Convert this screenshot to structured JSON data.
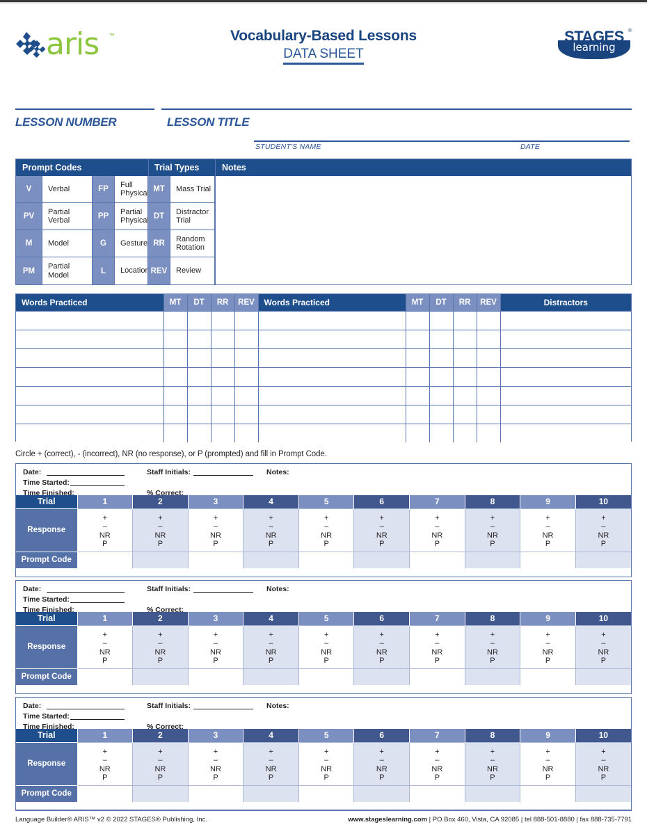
{
  "document": {
    "title": "Vocabulary-Based Lessons",
    "subtitle": "DATA SHEET",
    "brand_left": "aris",
    "brand_left_tm": "™",
    "brand_right_top": "STAGES",
    "brand_right_reg": "®",
    "brand_right_bottom": "learning"
  },
  "colors": {
    "header_blue": "#1f4e8c",
    "mid_blue": "#7b8fc0",
    "dark_cell_blue": "#41588f",
    "side_label_blue": "#5671a8",
    "tint_lavender": "#dde2f0",
    "rule_blue": "#2a5699",
    "border_blue": "#5a75ad",
    "logo_green": "#8cc63f"
  },
  "lesson": {
    "number_label": "LESSON NUMBER",
    "title_label": "LESSON TITLE",
    "student_name_label": "STUDENT'S NAME",
    "date_label": "DATE",
    "number_value": "",
    "title_value": "",
    "student_name_value": "",
    "date_value": ""
  },
  "prompt_codes": {
    "header_prompt_codes": "Prompt Codes",
    "header_trial_types": "Trial Types",
    "header_notes": "Notes",
    "notes_value": "",
    "column_a": [
      {
        "abbr": "V",
        "name": "Verbal"
      },
      {
        "abbr": "PV",
        "name": "Partial Verbal"
      },
      {
        "abbr": "M",
        "name": "Model"
      },
      {
        "abbr": "PM",
        "name": "Partial Model"
      }
    ],
    "column_b": [
      {
        "abbr": "FP",
        "name": "Full Physical"
      },
      {
        "abbr": "PP",
        "name": "Partial Physical"
      },
      {
        "abbr": "G",
        "name": "Gesture"
      },
      {
        "abbr": "L",
        "name": "Location"
      }
    ],
    "column_c": [
      {
        "abbr": "MT",
        "name": "Mass Trial"
      },
      {
        "abbr": "DT",
        "name": "Distractor Trial"
      },
      {
        "abbr": "RR",
        "name": "Random Rotation"
      },
      {
        "abbr": "REV",
        "name": "Review"
      }
    ]
  },
  "words_practiced": {
    "headers": {
      "words_1": "Words Practiced",
      "mt_1": "MT",
      "dt_1": "DT",
      "rr_1": "RR",
      "rev_1": "REV",
      "words_2": "Words Practiced",
      "mt_2": "MT",
      "dt_2": "DT",
      "rr_2": "RR",
      "rev_2": "REV",
      "distractors": "Distractors"
    },
    "row_count": 7,
    "rows": [
      {
        "words_1": "",
        "mt_1": "",
        "dt_1": "",
        "rr_1": "",
        "rev_1": "",
        "words_2": "",
        "mt_2": "",
        "dt_2": "",
        "rr_2": "",
        "rev_2": "",
        "distractors": ""
      },
      {
        "words_1": "",
        "mt_1": "",
        "dt_1": "",
        "rr_1": "",
        "rev_1": "",
        "words_2": "",
        "mt_2": "",
        "dt_2": "",
        "rr_2": "",
        "rev_2": "",
        "distractors": ""
      },
      {
        "words_1": "",
        "mt_1": "",
        "dt_1": "",
        "rr_1": "",
        "rev_1": "",
        "words_2": "",
        "mt_2": "",
        "dt_2": "",
        "rr_2": "",
        "rev_2": "",
        "distractors": ""
      },
      {
        "words_1": "",
        "mt_1": "",
        "dt_1": "",
        "rr_1": "",
        "rev_1": "",
        "words_2": "",
        "mt_2": "",
        "dt_2": "",
        "rr_2": "",
        "rev_2": "",
        "distractors": ""
      },
      {
        "words_1": "",
        "mt_1": "",
        "dt_1": "",
        "rr_1": "",
        "rev_1": "",
        "words_2": "",
        "mt_2": "",
        "dt_2": "",
        "rr_2": "",
        "rev_2": "",
        "distractors": ""
      },
      {
        "words_1": "",
        "mt_1": "",
        "dt_1": "",
        "rr_1": "",
        "rev_1": "",
        "words_2": "",
        "mt_2": "",
        "dt_2": "",
        "rr_2": "",
        "rev_2": "",
        "distractors": ""
      },
      {
        "words_1": "",
        "mt_1": "",
        "dt_1": "",
        "rr_1": "",
        "rev_1": "",
        "words_2": "",
        "mt_2": "",
        "dt_2": "",
        "rr_2": "",
        "rev_2": "",
        "distractors": ""
      }
    ]
  },
  "instruction": "Circle + (correct), - (incorrect), NR (no response), or P (prompted) and fill in Prompt Code.",
  "trial_meta_labels": {
    "date": "Date:",
    "time_started": "Time Started:",
    "time_finished": "Time Finished:",
    "staff_initials": "Staff Initials:",
    "percent_correct": "% Correct:",
    "notes": "Notes:"
  },
  "trial_grid": {
    "row_label_trial": "Trial",
    "row_label_response": "Response",
    "row_label_prompt_code": "Prompt Code",
    "trial_numbers": [
      "1",
      "2",
      "3",
      "4",
      "5",
      "6",
      "7",
      "8",
      "9",
      "10"
    ],
    "response_options": [
      "+",
      "–",
      "NR",
      "P"
    ]
  },
  "trial_blocks": [
    {
      "date": "",
      "time_started": "",
      "time_finished": "",
      "staff_initials": "",
      "percent_correct": "",
      "notes": "",
      "prompt_codes": [
        "",
        "",
        "",
        "",
        "",
        "",
        "",
        "",
        "",
        ""
      ]
    },
    {
      "date": "",
      "time_started": "",
      "time_finished": "",
      "staff_initials": "",
      "percent_correct": "",
      "notes": "",
      "prompt_codes": [
        "",
        "",
        "",
        "",
        "",
        "",
        "",
        "",
        "",
        ""
      ]
    },
    {
      "date": "",
      "time_started": "",
      "time_finished": "",
      "staff_initials": "",
      "percent_correct": "",
      "notes": "",
      "prompt_codes": [
        "",
        "",
        "",
        "",
        "",
        "",
        "",
        "",
        "",
        ""
      ]
    }
  ],
  "footer": {
    "left": "Language Builder® ARIS™ v2 © 2022 STAGES® Publishing, Inc.",
    "right_site": "www.stageslearning.com",
    "right_rest": " | PO Box 460, Vista, CA 92085 | tel 888-501-8880 | fax 888-735-7791"
  }
}
